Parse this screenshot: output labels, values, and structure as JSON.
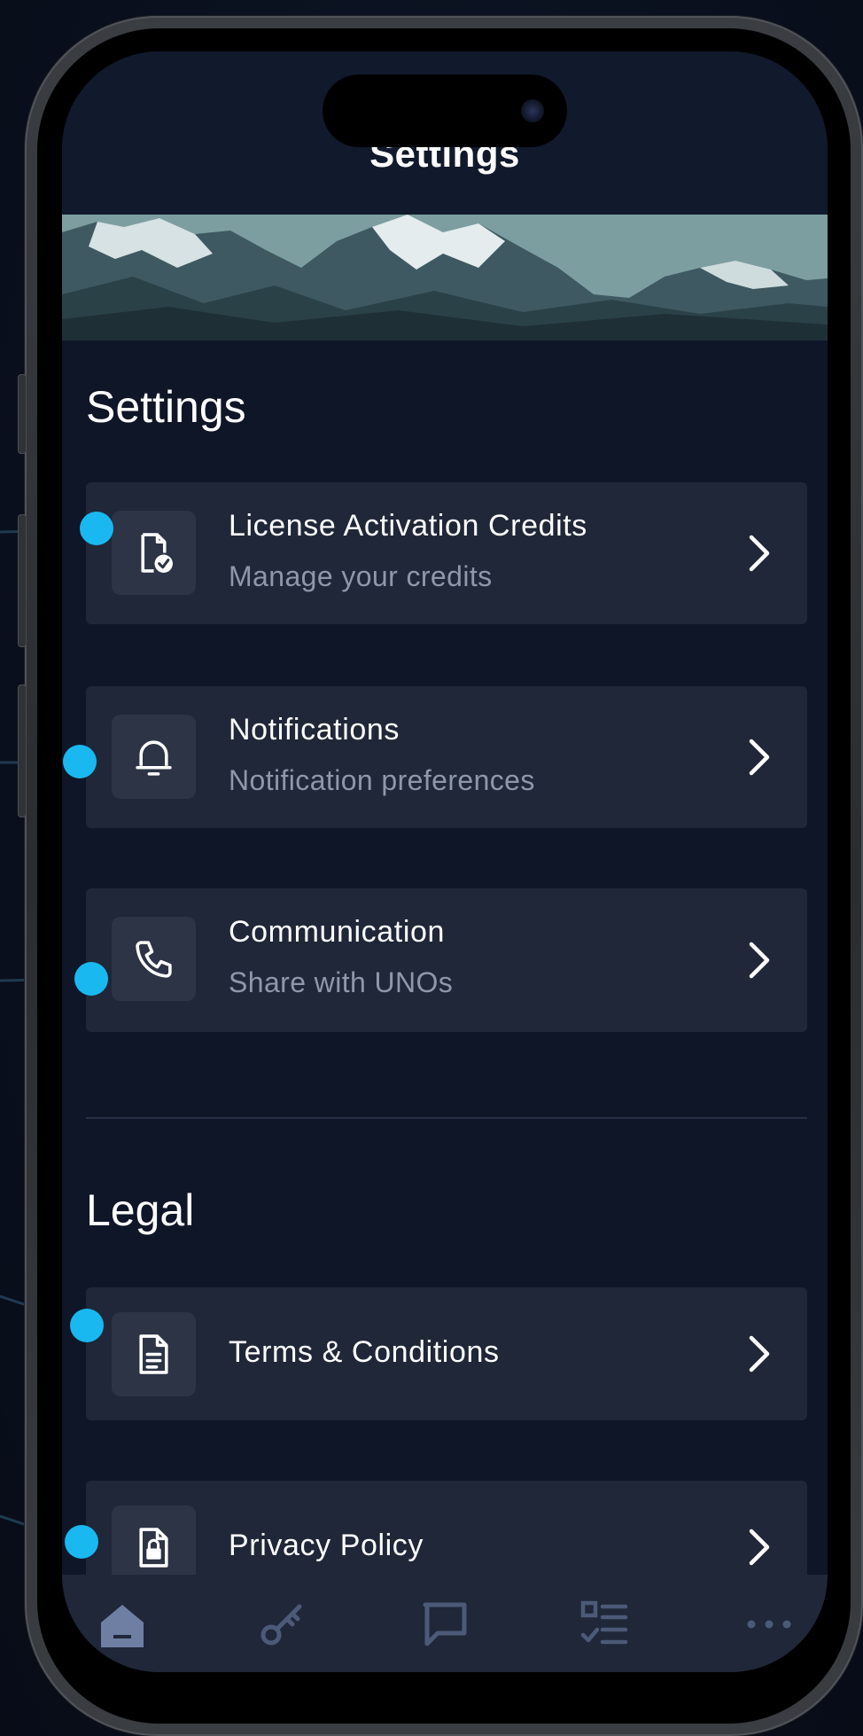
{
  "header": {
    "title": "Settings"
  },
  "sections": {
    "settings": {
      "title": "Settings",
      "items": [
        {
          "title": "License Activation Credits",
          "subtitle": "Manage your credits",
          "icon": "license-file-check-icon"
        },
        {
          "title": "Notifications",
          "subtitle": "Notification preferences",
          "icon": "bell-icon"
        },
        {
          "title": "Communication",
          "subtitle": "Share with UNOs",
          "icon": "phone-icon"
        }
      ]
    },
    "legal": {
      "title": "Legal",
      "items": [
        {
          "title": "Terms & Conditions",
          "icon": "document-icon"
        },
        {
          "title": "Privacy Policy",
          "icon": "lock-document-icon"
        }
      ]
    }
  },
  "bottom_nav": {
    "items": [
      {
        "icon": "home-icon",
        "active": true
      },
      {
        "icon": "key-icon",
        "active": false
      },
      {
        "icon": "chat-icon",
        "active": false
      },
      {
        "icon": "checklist-icon",
        "active": false
      },
      {
        "icon": "more-icon",
        "active": false
      }
    ]
  },
  "colors": {
    "background": "#0f1628",
    "card": "#1f2738",
    "icon_box": "#2c3446",
    "subtitle": "#8e98aa",
    "nav_icon": "#4c5a78",
    "nav_icon_active": "#6e7fa3",
    "annotation_dot": "#19b8f0"
  }
}
